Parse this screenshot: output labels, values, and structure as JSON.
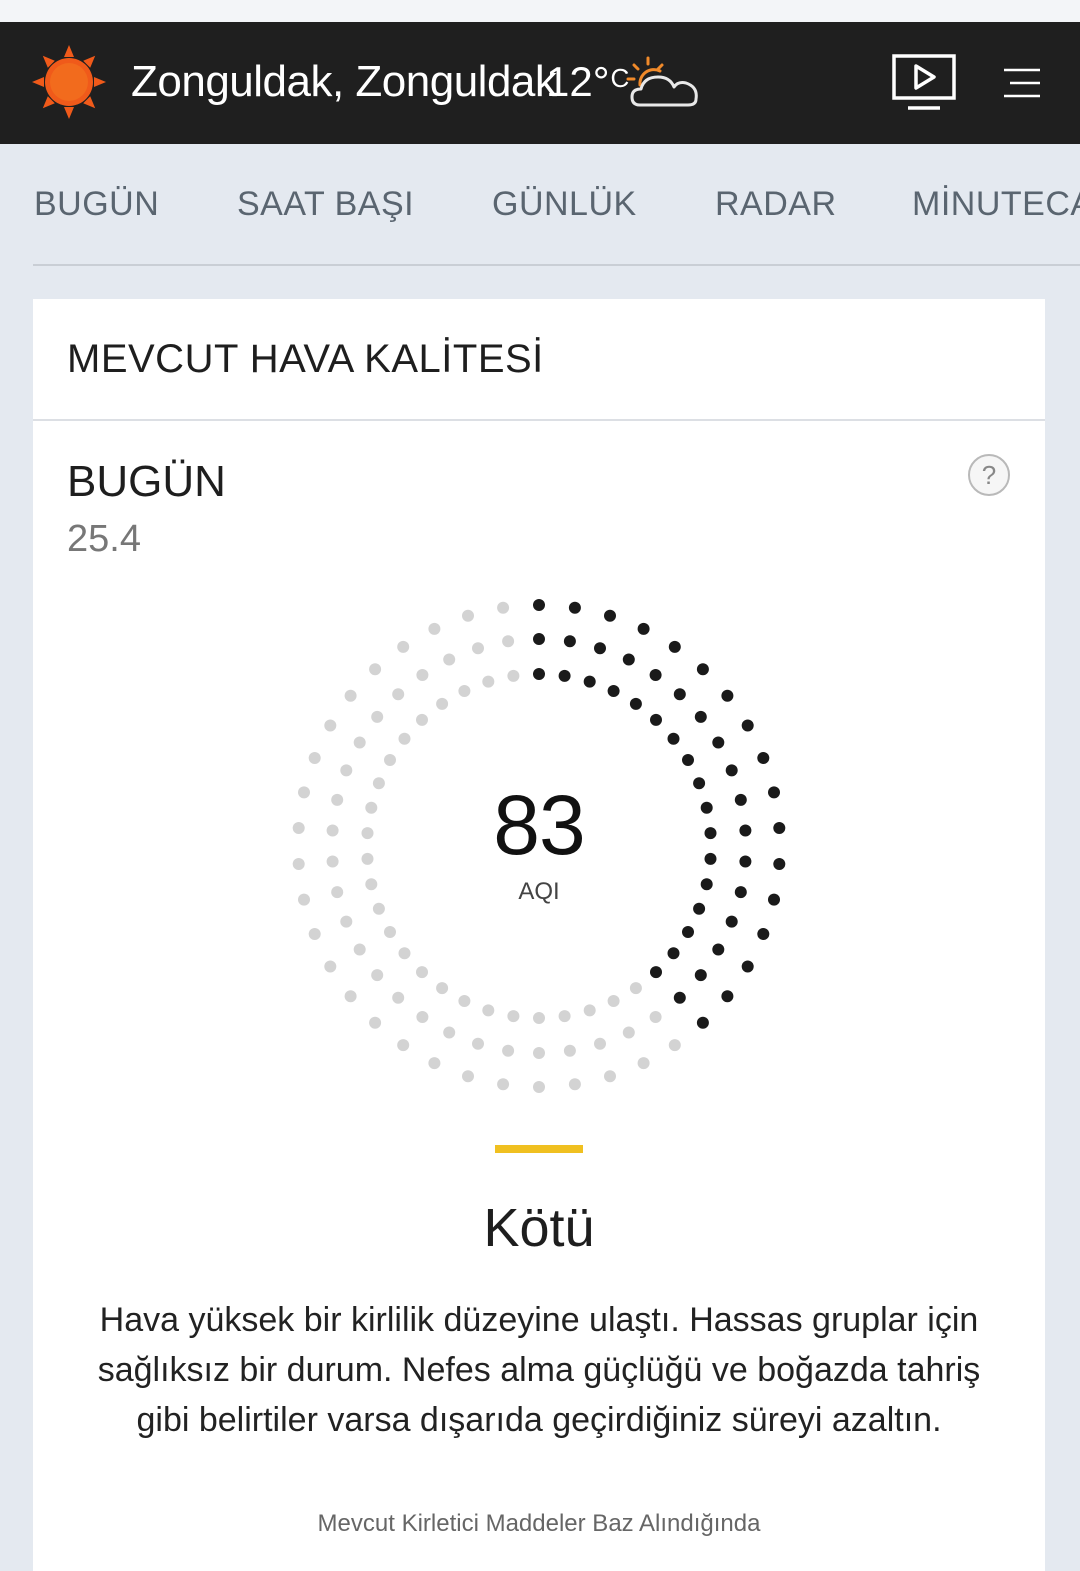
{
  "header": {
    "location": "Zonguldak, Zonguldak",
    "temperature": "12°",
    "temperature_unit": "C",
    "weather_icon": "partly-cloudy-day-icon",
    "logo_icon": "sun-logo-icon",
    "video_icon": "video-play-icon",
    "menu_icon": "hamburger-menu-icon",
    "background_color": "#1f1f1f",
    "brand_color": "#f05a1a"
  },
  "tabs": [
    {
      "label": "BUGÜN"
    },
    {
      "label": "SAAT BAŞI"
    },
    {
      "label": "GÜNLÜK"
    },
    {
      "label": "RADAR"
    },
    {
      "label": "MİNUTECA"
    }
  ],
  "card": {
    "title": "MEVCUT HAVA KALİTESİ",
    "today_label": "BUGÜN",
    "today_value": "25.4",
    "help_label": "?",
    "aqi": {
      "value": "83",
      "label": "AQI",
      "max": 500,
      "active_color": "#1a1a1a",
      "inactive_color": "#d3d3d3"
    },
    "category": {
      "label": "Kötü",
      "color": "#f0c020"
    },
    "description": "Hava yüksek bir kirlilik düzeyine ulaştı. Hassas gruplar için sağlıksız bir durum. Nefes alma güçlüğü ve boğazda tahriş gibi belirtiler varsa dışarıda geçirdiğiniz süreyi azaltın.",
    "footnote": "Mevcut Kirletici Maddeler Baz Alındığında"
  }
}
